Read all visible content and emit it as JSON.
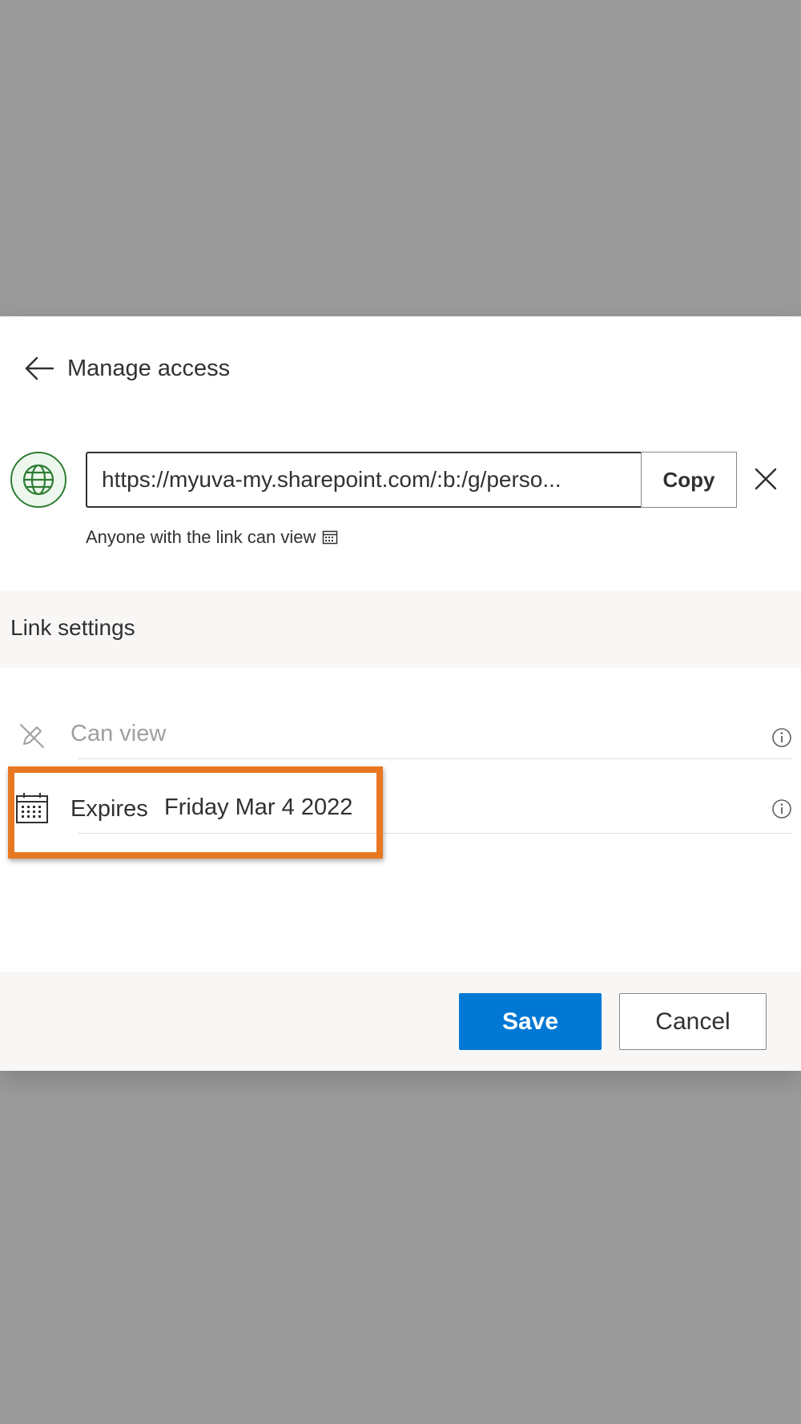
{
  "header": {
    "title": "Manage access"
  },
  "link": {
    "url": "https://myuva-my.sharepoint.com/:b:/g/perso...",
    "copy_label": "Copy",
    "description": "Anyone with the link can view"
  },
  "settings": {
    "title": "Link settings",
    "permission_label": "Can view",
    "expires_label": "Expires",
    "expires_value": "Friday Mar 4 2022"
  },
  "footer": {
    "save_label": "Save",
    "cancel_label": "Cancel"
  },
  "colors": {
    "overlay": "#9b9b9b",
    "accent": "#0078d4",
    "highlight": "#e87722",
    "globe": "#2e7d32"
  },
  "icons": {
    "back": "arrow-left-icon",
    "globe": "globe-icon",
    "close": "close-icon",
    "calendar": "calendar-icon",
    "no_edit": "pencil-off-icon",
    "info": "info-icon"
  }
}
